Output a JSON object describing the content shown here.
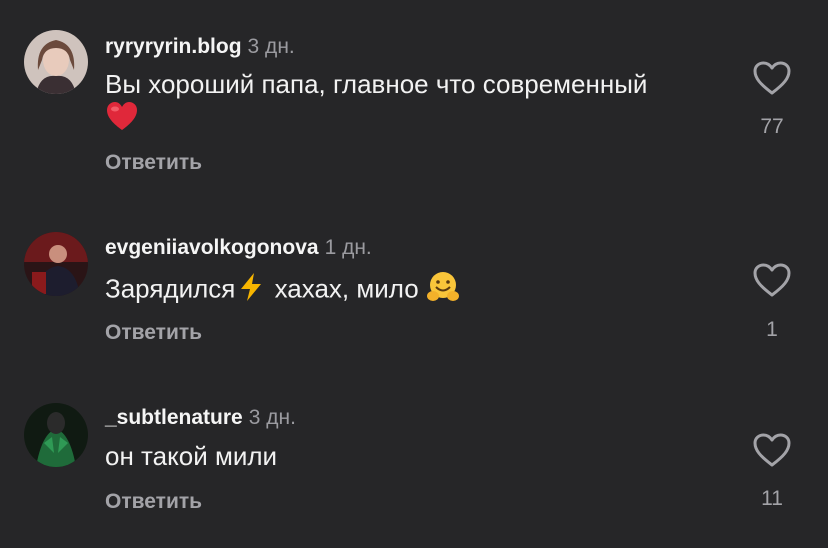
{
  "reply_label": "Ответить",
  "icons": {
    "like": "heart-outline-icon"
  },
  "comments": [
    {
      "username": "ryryryrin.blog",
      "time": "3 дн.",
      "text": "Вы хороший папа, главное что современный",
      "emoji": "red-heart",
      "likes": "77"
    },
    {
      "username": "evgeniiavolkogonova",
      "time": "1 дн.",
      "text_a": "Зарядился",
      "emoji_a": "lightning",
      "text_b": " хахах, мило ",
      "emoji_b": "hugging-face",
      "likes": "1"
    },
    {
      "username": "_subtlenature",
      "time": "3 дн.",
      "text": "он такой мили",
      "likes": "11"
    }
  ]
}
